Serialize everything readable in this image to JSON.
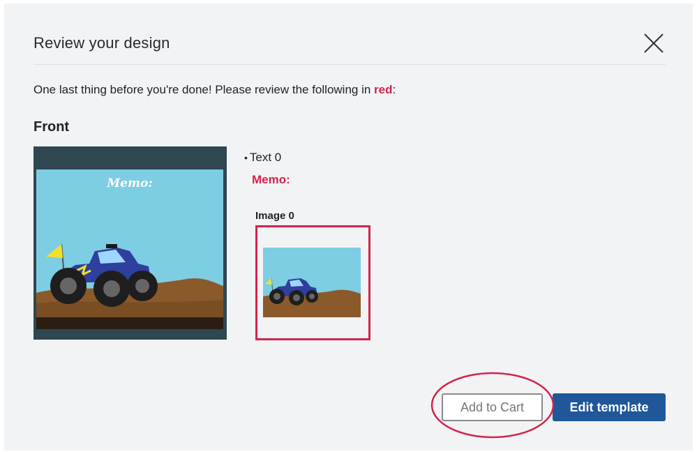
{
  "modal": {
    "title": "Review your design",
    "close_icon": "close-icon"
  },
  "instructions": {
    "prefix": "One last thing before you're done! Please review the following in ",
    "highlight": "red",
    "suffix": ":"
  },
  "section": {
    "title": "Front"
  },
  "preview": {
    "memo_text": "Memo:"
  },
  "review_items": {
    "text_item": "Text 0",
    "memo_label": "Memo:",
    "image_label": "Image 0"
  },
  "buttons": {
    "add_to_cart": "Add to Cart",
    "edit_template": "Edit template"
  },
  "colors": {
    "alert_red": "#d4234a",
    "primary_blue": "#1f5799"
  }
}
